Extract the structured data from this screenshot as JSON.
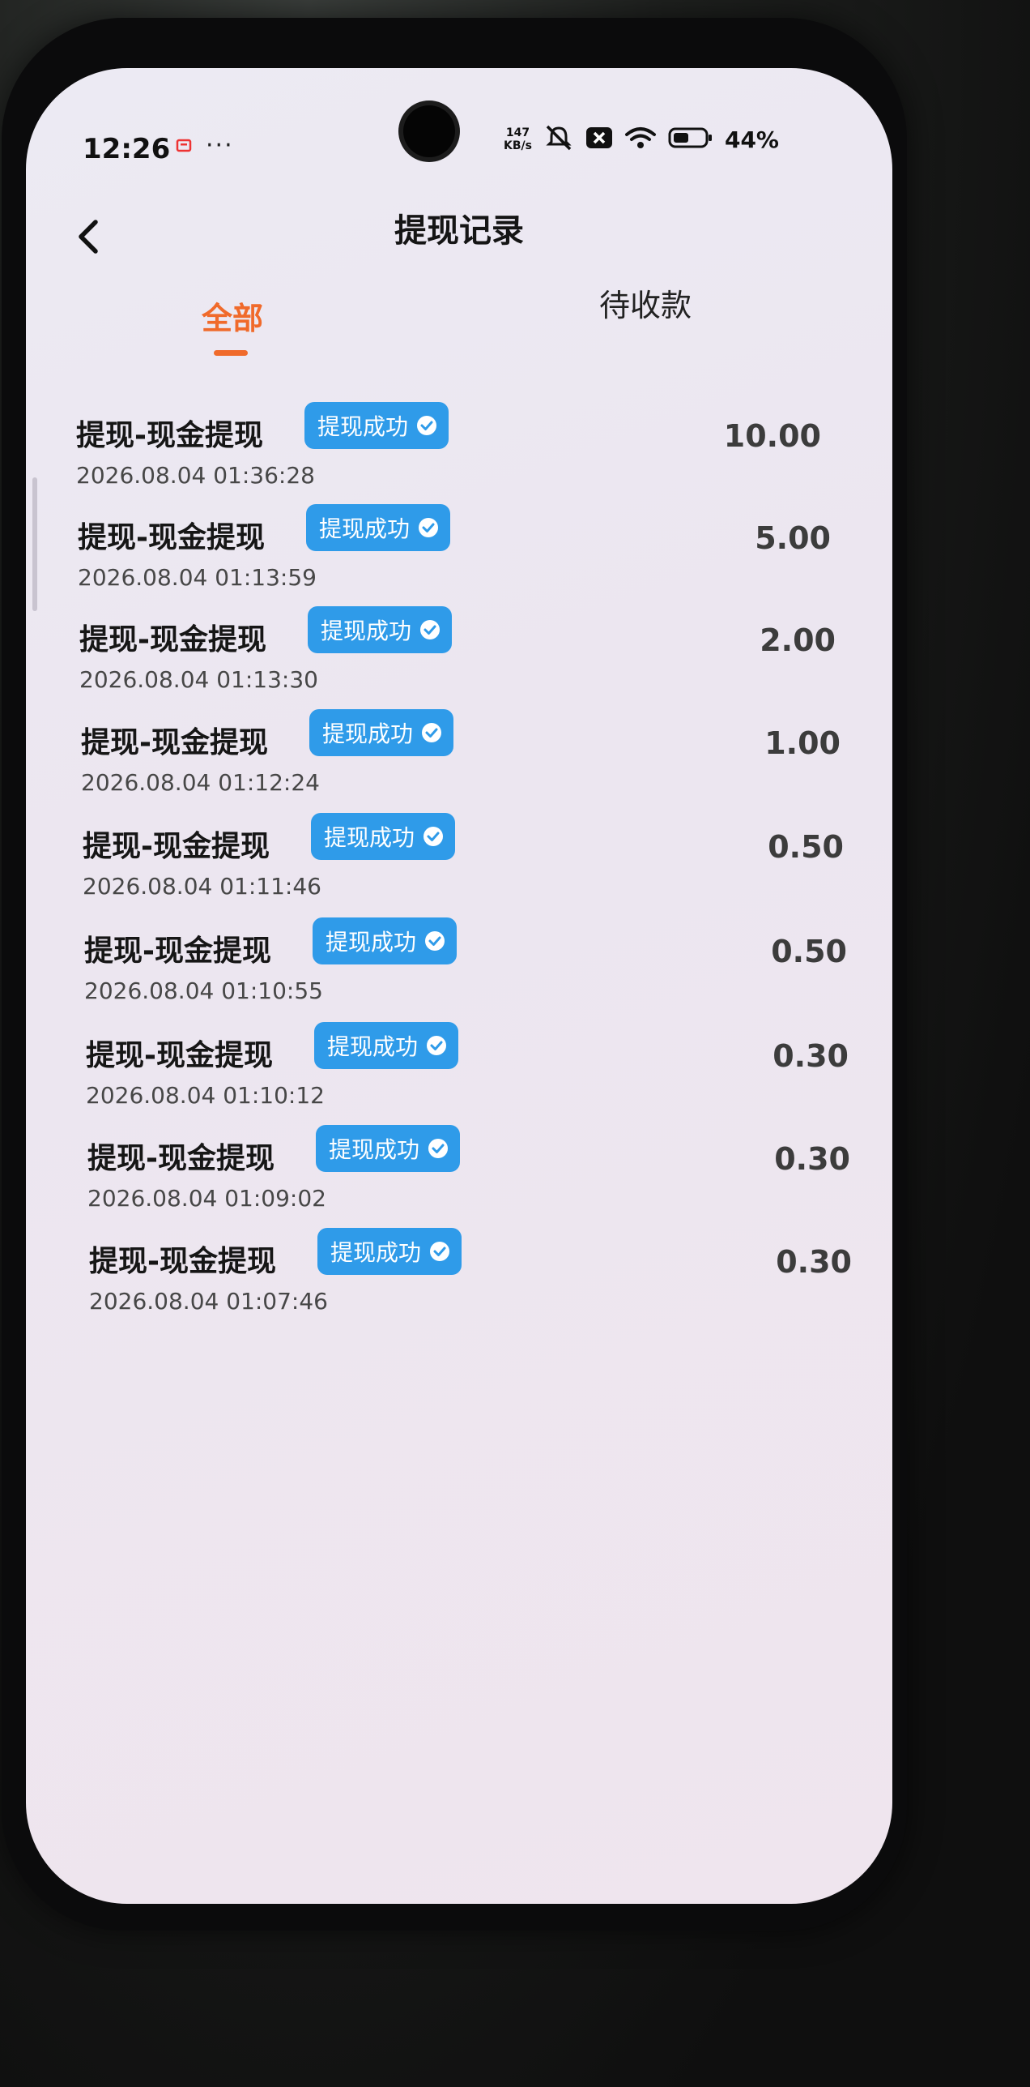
{
  "status_bar": {
    "time": "12:26",
    "dots": "···",
    "net_speed_value": "147",
    "net_speed_unit": "KB/s",
    "battery": "44%",
    "icons": [
      "message-icon",
      "mute-icon",
      "sim-x-icon",
      "wifi-icon",
      "battery-icon"
    ]
  },
  "header": {
    "title": "提现记录",
    "back_icon": "chevron-left-icon"
  },
  "tabs": [
    {
      "label": "全部",
      "active": true
    },
    {
      "label": "待收款",
      "active": false
    }
  ],
  "colors": {
    "accent": "#f06a2b",
    "badge": "#2f9be9"
  },
  "records": [
    {
      "title": "提现-现金提现",
      "status": "提现成功",
      "time": "2026.08.04 01:36:28",
      "amount": "10.00"
    },
    {
      "title": "提现-现金提现",
      "status": "提现成功",
      "time": "2026.08.04 01:13:59",
      "amount": "5.00"
    },
    {
      "title": "提现-现金提现",
      "status": "提现成功",
      "time": "2026.08.04 01:13:30",
      "amount": "2.00"
    },
    {
      "title": "提现-现金提现",
      "status": "提现成功",
      "time": "2026.08.04 01:12:24",
      "amount": "1.00"
    },
    {
      "title": "提现-现金提现",
      "status": "提现成功",
      "time": "2026.08.04 01:11:46",
      "amount": "0.50"
    },
    {
      "title": "提现-现金提现",
      "status": "提现成功",
      "time": "2026.08.04 01:10:55",
      "amount": "0.50"
    },
    {
      "title": "提现-现金提现",
      "status": "提现成功",
      "time": "2026.08.04 01:10:12",
      "amount": "0.30"
    },
    {
      "title": "提现-现金提现",
      "status": "提现成功",
      "time": "2026.08.04 01:09:02",
      "amount": "0.30"
    },
    {
      "title": "提现-现金提现",
      "status": "提现成功",
      "time": "2026.08.04 01:07:46",
      "amount": "0.30"
    }
  ]
}
